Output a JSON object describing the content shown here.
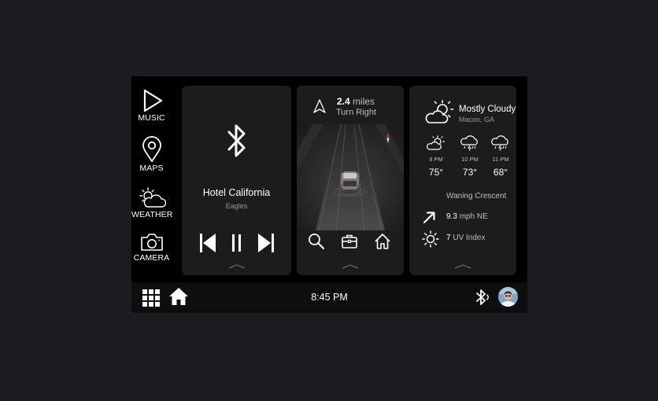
{
  "sidebar": {
    "items": [
      {
        "label": "MUSIC",
        "icon": "play-icon"
      },
      {
        "label": "MAPS",
        "icon": "map-pin-icon"
      },
      {
        "label": "WEATHER",
        "icon": "partly-sunny-icon"
      },
      {
        "label": "CAMERA",
        "icon": "camera-icon"
      }
    ]
  },
  "music": {
    "source_icon": "bluetooth-icon",
    "title": "Hotel California",
    "artist": "Eagles",
    "controls": [
      "previous",
      "pause",
      "next"
    ]
  },
  "navigation": {
    "distance_value": "2.4",
    "distance_unit": "miles",
    "instruction": "Turn Right",
    "actions": [
      "search",
      "briefcase",
      "home"
    ]
  },
  "weather": {
    "condition": "Mostly Cloudy",
    "location": "Macon, GA",
    "forecast": [
      {
        "time": "9 PM",
        "temp": "75°",
        "icon": "partly-cloudy-icon"
      },
      {
        "time": "10 PM",
        "temp": "73°",
        "icon": "storm-cloud-icon"
      },
      {
        "time": "11 PM",
        "temp": "68°",
        "icon": "storm-cloud-icon"
      }
    ],
    "moon": "Waning Crescent",
    "wind_value": "9.3",
    "wind_unit": "mph NE",
    "uv_value": "7",
    "uv_label": "UV Index"
  },
  "bottom_bar": {
    "time": "8:45 PM"
  },
  "colors": {
    "page_background": "#1b1c1f",
    "screen_background": "#000000",
    "card_background": "#1c1c1c",
    "text_primary": "#ffffff",
    "text_secondary": "#9a9a9a"
  }
}
